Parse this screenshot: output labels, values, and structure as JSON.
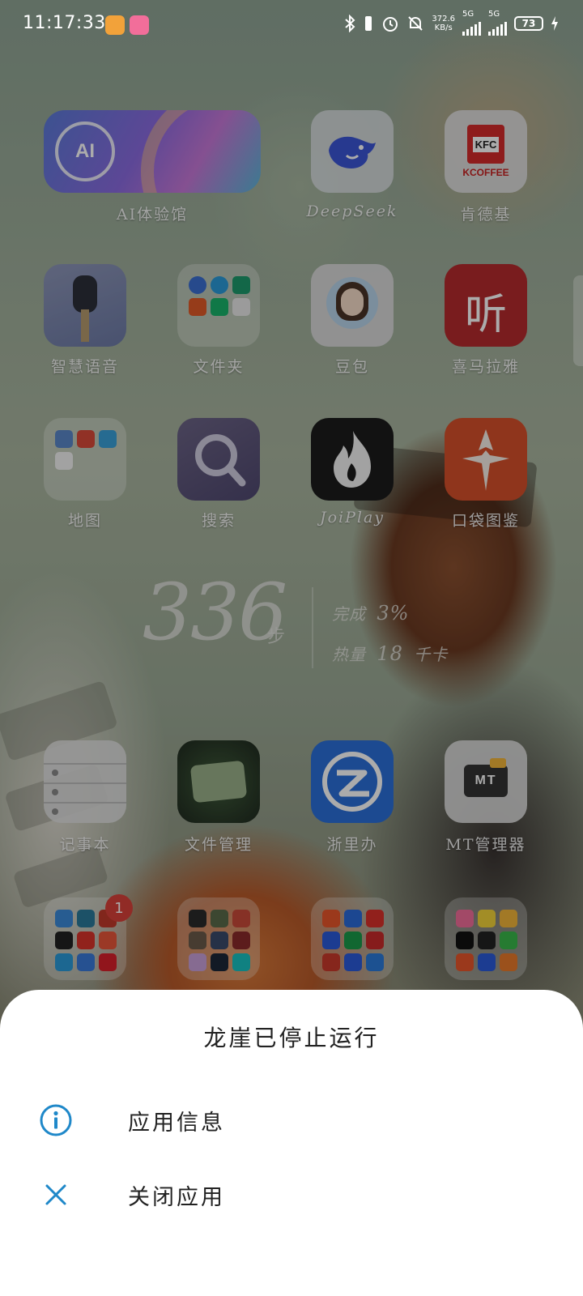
{
  "status_bar": {
    "time": "11:17:33",
    "net_speed_value": "372.6",
    "net_speed_unit": "KB/s",
    "sim1_label": "5G",
    "sim2_label": "5G",
    "battery_level": "73",
    "icons": [
      "bluetooth-icon",
      "alarm-icon",
      "bell-off-icon",
      "charging-icon"
    ]
  },
  "home": {
    "row1": [
      {
        "label": "AI体验馆",
        "icon_text": "AI"
      },
      {
        "label": "DeepSeek"
      },
      {
        "label": "肯德基",
        "icon_text": "KFC",
        "icon_subtext": "KCOFFEE"
      }
    ],
    "row2": [
      {
        "label": "智慧语音"
      },
      {
        "label": "文件夹"
      },
      {
        "label": "豆包"
      },
      {
        "label": "喜马拉雅",
        "icon_text": "听"
      }
    ],
    "row3": [
      {
        "label": "地图"
      },
      {
        "label": "搜索"
      },
      {
        "label": "JoiPlay"
      },
      {
        "label": "口袋图鉴"
      }
    ],
    "row5": [
      {
        "label": "记事本"
      },
      {
        "label": "文件管理"
      },
      {
        "label": "浙里办"
      },
      {
        "label": "MT管理器",
        "icon_text": "MT"
      }
    ],
    "dock_badge": "1"
  },
  "step_widget": {
    "steps": "336",
    "unit": "步",
    "complete_label": "完成",
    "complete_value": "3%",
    "calorie_label": "热量",
    "calorie_value": "18",
    "calorie_unit": "千卡"
  },
  "dialog": {
    "title": "龙崖已停止运行",
    "actions": [
      {
        "label": "应用信息",
        "icon": "info-icon"
      },
      {
        "label": "关闭应用",
        "icon": "close-icon"
      }
    ]
  },
  "colors": {
    "accent": "#1f88c9",
    "sheet_bg": "#ffffff",
    "badge": "#d9403a"
  }
}
